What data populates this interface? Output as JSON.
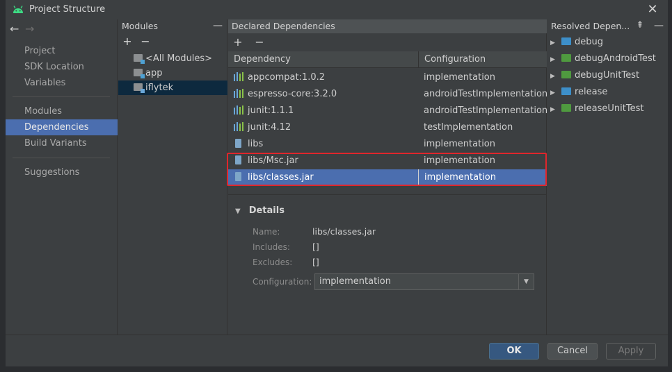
{
  "window": {
    "title": "Project Structure"
  },
  "nav": {
    "items": [
      {
        "label": "Project"
      },
      {
        "label": "SDK Location"
      },
      {
        "label": "Variables"
      },
      {
        "label": "Modules"
      },
      {
        "label": "Dependencies",
        "active": true
      },
      {
        "label": "Build Variants"
      },
      {
        "label": "Suggestions"
      }
    ]
  },
  "modules": {
    "header": "Modules",
    "items": [
      {
        "label": "<All Modules>"
      },
      {
        "label": "app"
      },
      {
        "label": "iflytek",
        "selected": true
      }
    ]
  },
  "declared": {
    "header": "Declared Dependencies",
    "columns": {
      "dependency": "Dependency",
      "configuration": "Configuration"
    },
    "rows": [
      {
        "dependency": "appcompat:1.0.2",
        "configuration": "implementation",
        "icon": "library-icon"
      },
      {
        "dependency": "espresso-core:3.2.0",
        "configuration": "androidTestImplementation",
        "icon": "library-icon"
      },
      {
        "dependency": "junit:1.1.1",
        "configuration": "androidTestImplementation",
        "icon": "library-icon"
      },
      {
        "dependency": "junit:4.12",
        "configuration": "testImplementation",
        "icon": "library-icon"
      },
      {
        "dependency": "libs",
        "configuration": "implementation",
        "icon": "jar-icon"
      },
      {
        "dependency": "libs/Msc.jar",
        "configuration": "implementation",
        "icon": "jar-icon"
      },
      {
        "dependency": "libs/classes.jar",
        "configuration": "implementation",
        "icon": "jar-icon",
        "selected": true
      }
    ]
  },
  "details": {
    "title": "Details",
    "name_label": "Name:",
    "name_value": "libs/classes.jar",
    "includes_label": "Includes:",
    "includes_value": "[]",
    "excludes_label": "Excludes:",
    "excludes_value": "[]",
    "configuration_label": "Configuration:",
    "configuration_value": "implementation"
  },
  "resolved": {
    "header": "Resolved Depen...",
    "items": [
      {
        "label": "debug",
        "color": "#3d8fc9"
      },
      {
        "label": "debugAndroidTest",
        "color": "#4f9a3f"
      },
      {
        "label": "debugUnitTest",
        "color": "#4f9a3f"
      },
      {
        "label": "release",
        "color": "#3d8fc9"
      },
      {
        "label": "releaseUnitTest",
        "color": "#4f9a3f"
      }
    ]
  },
  "buttons": {
    "ok": "OK",
    "cancel": "Cancel",
    "apply": "Apply"
  },
  "colors": {
    "accent": "#4b6eaf",
    "highlight": "#e0262b"
  }
}
